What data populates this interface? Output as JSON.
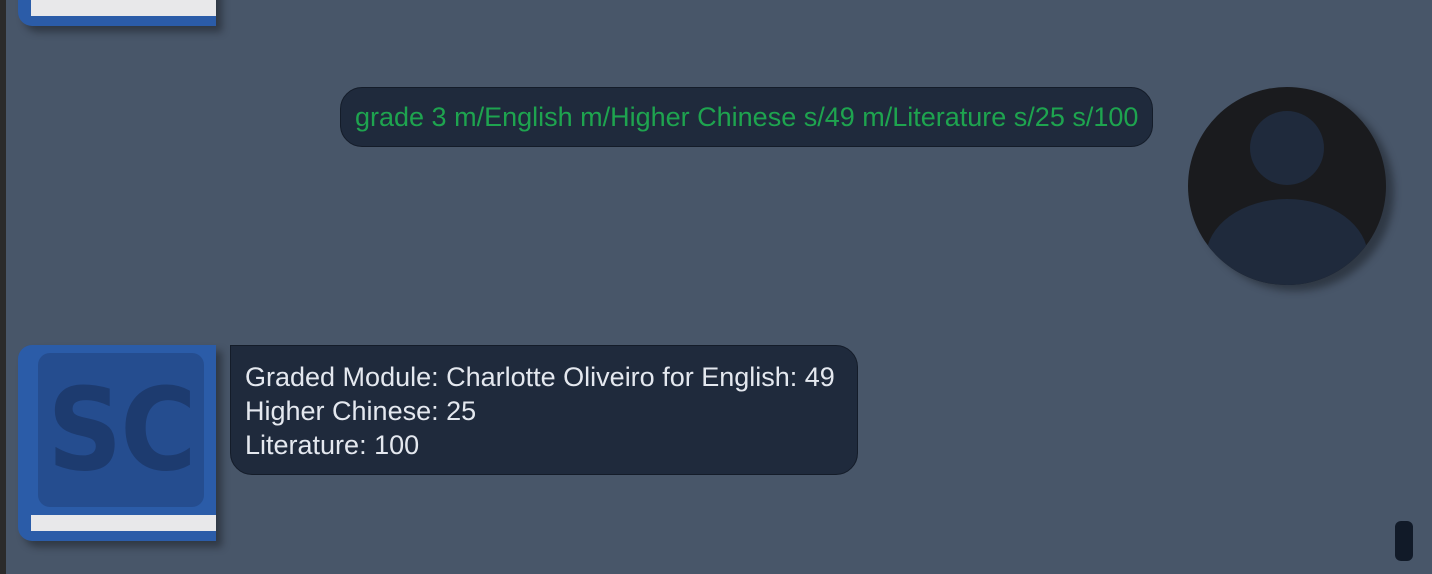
{
  "bot": {
    "avatar_text": "SC"
  },
  "user_message": {
    "text": "grade 3 m/English m/Higher Chinese s/49 m/Literature s/25 s/100"
  },
  "bot_response": {
    "lines": [
      "Graded Module: Charlotte Oliveiro for English: 49",
      "Higher Chinese: 25",
      "Literature: 100"
    ]
  },
  "colors": {
    "background": "#485669",
    "bubble": "#1f2a3c",
    "user_text": "#1ea44f",
    "bot_text": "#e4e8ef",
    "bot_avatar": "#2b5ca8"
  }
}
